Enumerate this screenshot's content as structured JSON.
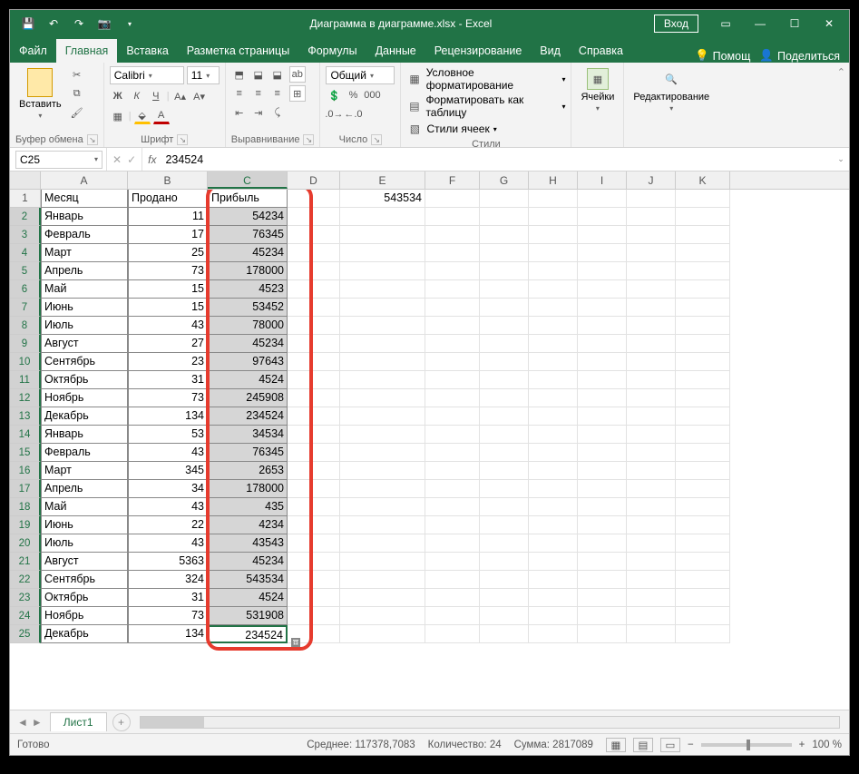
{
  "title": {
    "document": "Диаграмма в диаграмме.xlsx",
    "app": "Excel",
    "sep": " - "
  },
  "titlebar": {
    "login": "Вход"
  },
  "menu": {
    "tabs": [
      "Файл",
      "Главная",
      "Вставка",
      "Разметка страницы",
      "Формулы",
      "Данные",
      "Рецензирование",
      "Вид",
      "Справка"
    ],
    "activeIndex": 1,
    "help": "Помощ",
    "share": "Поделиться"
  },
  "ribbon": {
    "clipboard": {
      "paste": "Вставить",
      "label": "Буфер обмена"
    },
    "font": {
      "name": "Calibri",
      "size": "11",
      "bold": "Ж",
      "italic": "К",
      "underline": "Ч",
      "label": "Шрифт"
    },
    "alignment": {
      "wrap": "ab",
      "label": "Выравнивание"
    },
    "number": {
      "format": "Общий",
      "label": "Число"
    },
    "styles": {
      "cond": "Условное форматирование",
      "table": "Форматировать как таблицу",
      "cell": "Стили ячеек",
      "label": "Стили"
    },
    "cells": {
      "label": "Ячейки"
    },
    "editing": {
      "label": "Редактирование"
    }
  },
  "fbar": {
    "name": "C25",
    "formula": "234524"
  },
  "columns": [
    "A",
    "B",
    "C",
    "D",
    "E",
    "F",
    "G",
    "H",
    "I",
    "J",
    "K"
  ],
  "selectedCol": "C",
  "activeCell": "C25",
  "headers": {
    "A": "Месяц",
    "B": "Продано",
    "C": "Прибыль"
  },
  "floatE1": "543534",
  "rows": [
    {
      "n": 1
    },
    {
      "n": 2,
      "A": "Январь",
      "B": "11",
      "C": "54234"
    },
    {
      "n": 3,
      "A": "Февраль",
      "B": "17",
      "C": "76345"
    },
    {
      "n": 4,
      "A": "Март",
      "B": "25",
      "C": "45234"
    },
    {
      "n": 5,
      "A": "Апрель",
      "B": "73",
      "C": "178000"
    },
    {
      "n": 6,
      "A": "Май",
      "B": "15",
      "C": "4523"
    },
    {
      "n": 7,
      "A": "Июнь",
      "B": "15",
      "C": "53452"
    },
    {
      "n": 8,
      "A": "Июль",
      "B": "43",
      "C": "78000"
    },
    {
      "n": 9,
      "A": "Август",
      "B": "27",
      "C": "45234"
    },
    {
      "n": 10,
      "A": "Сентябрь",
      "B": "23",
      "C": "97643"
    },
    {
      "n": 11,
      "A": "Октябрь",
      "B": "31",
      "C": "4524"
    },
    {
      "n": 12,
      "A": "Ноябрь",
      "B": "73",
      "C": "245908"
    },
    {
      "n": 13,
      "A": "Декабрь",
      "B": "134",
      "C": "234524"
    },
    {
      "n": 14,
      "A": "Январь",
      "B": "53",
      "C": "34534"
    },
    {
      "n": 15,
      "A": "Февраль",
      "B": "43",
      "C": "76345"
    },
    {
      "n": 16,
      "A": "Март",
      "B": "345",
      "C": "2653"
    },
    {
      "n": 17,
      "A": "Апрель",
      "B": "34",
      "C": "178000"
    },
    {
      "n": 18,
      "A": "Май",
      "B": "43",
      "C": "435"
    },
    {
      "n": 19,
      "A": "Июнь",
      "B": "22",
      "C": "4234"
    },
    {
      "n": 20,
      "A": "Июль",
      "B": "43",
      "C": "43543"
    },
    {
      "n": 21,
      "A": "Август",
      "B": "5363",
      "C": "45234"
    },
    {
      "n": 22,
      "A": "Сентябрь",
      "B": "324",
      "C": "543534"
    },
    {
      "n": 23,
      "A": "Октябрь",
      "B": "31",
      "C": "4524"
    },
    {
      "n": 24,
      "A": "Ноябрь",
      "B": "73",
      "C": "531908"
    },
    {
      "n": 25,
      "A": "Декабрь",
      "B": "134",
      "C": "234524"
    }
  ],
  "sheet": {
    "name": "Лист1"
  },
  "status": {
    "ready": "Готово",
    "avg_label": "Среднее:",
    "avg": "117378,7083",
    "count_label": "Количество:",
    "count": "24",
    "sum_label": "Сумма:",
    "sum": "2817089",
    "zoom": "100 %"
  }
}
